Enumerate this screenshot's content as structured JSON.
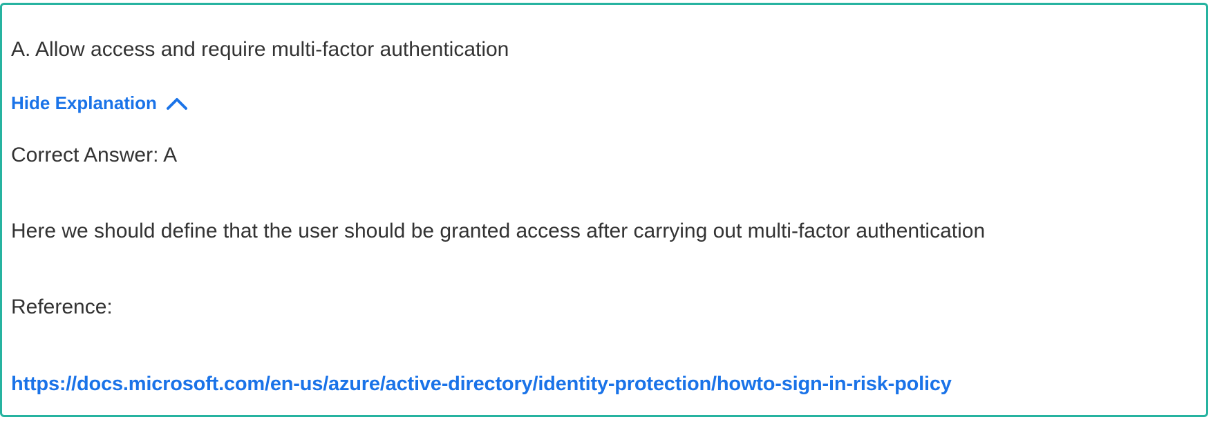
{
  "question": {
    "selected_option": "A. Allow access and require multi-factor authentication"
  },
  "explanation_toggle": {
    "label": "Hide Explanation",
    "icon": "chevron-up-icon"
  },
  "explanation": {
    "correct_answer": "Correct Answer: A",
    "body": "Here we should define that the user should be granted access after carrying out multi-factor authentication",
    "reference_label": "Reference:",
    "reference_link": "https://docs.microsoft.com/en-us/azure/active-directory/identity-protection/howto-sign-in-risk-policy"
  },
  "colors": {
    "border": "#26b3a0",
    "link": "#1a73e8",
    "text": "#333333"
  }
}
